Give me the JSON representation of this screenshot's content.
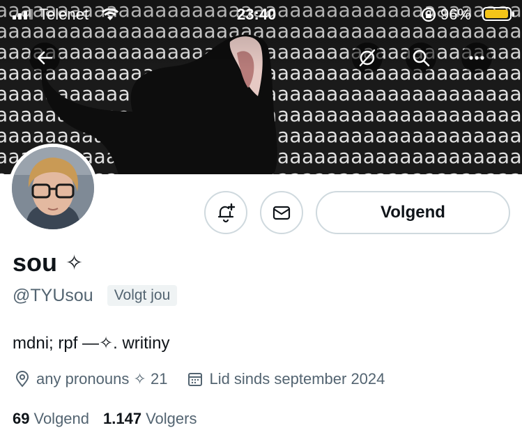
{
  "status_bar": {
    "carrier": "Telenet",
    "time": "23:40",
    "battery": "96%",
    "battery_level": 0.96,
    "battery_color": "#f5c518"
  },
  "banner": {
    "pattern_text": "aaaaaaaaaaaaaaaaaaaaaaaaaaaaaaaaaaaaaaaaaaaa"
  },
  "nav": {
    "back_icon": "arrow-left-icon",
    "grok_icon": "grok-icon",
    "search_icon": "search-icon",
    "more_icon": "more-icon"
  },
  "actions": {
    "notify_icon": "bell-plus-icon",
    "message_icon": "envelope-icon",
    "following_label": "Volgend"
  },
  "profile": {
    "display_name": "sou",
    "name_emoji": "✧",
    "handle": "@TYUsou",
    "follows_you": "Volgt jou",
    "bio": "mdni; rpf —✧. writiny",
    "location": "any pronouns ✧ 21",
    "joined": "Lid sinds september 2024"
  },
  "stats": {
    "following_count": "69",
    "following_label": "Volgend",
    "followers_count": "1.147",
    "followers_label": "Volgers"
  },
  "colors": {
    "text_primary": "#0f1419",
    "text_secondary": "#536471",
    "border": "#cfd9de"
  }
}
